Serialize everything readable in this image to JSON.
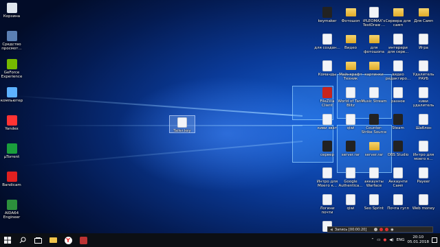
{
  "left_icons": [
    {
      "label": "Корзина",
      "icon": "recycle-bin-icon",
      "color": "#dfe6ee"
    },
    {
      "label": "Средство просмот...",
      "icon": "image-viewer-icon",
      "color": "#5b7fb3"
    },
    {
      "label": "GeForce Experience",
      "icon": "geforce-icon",
      "color": "#76b900"
    },
    {
      "label": "компьютер",
      "icon": "computer-icon",
      "color": "#5db2ff"
    },
    {
      "label": "Yandex",
      "icon": "yandex-browser-icon",
      "color": "#ff3333"
    },
    {
      "label": "µTorrent",
      "icon": "utorrent-icon",
      "color": "#1a9e3c"
    },
    {
      "label": "Bandicam",
      "icon": "bandicam-icon",
      "color": "#e02020"
    },
    {
      "label": "AIDA64 Engineer",
      "icon": "aida64-icon",
      "color": "#2c8f3c"
    }
  ],
  "center_file": {
    "label": "Tailer.key",
    "icon": "document-icon"
  },
  "right_icons": [
    {
      "label": "keymaker",
      "icon": "keymaker-icon",
      "type": "dark"
    },
    {
      "label": "Фотошоп",
      "icon": "folder-icon",
      "type": "folder"
    },
    {
      "label": "iPLEOMAX's TestDraw ...",
      "icon": "document-icon",
      "type": "doc"
    },
    {
      "label": "Сервера для самп",
      "icon": "folder-icon",
      "type": "folder"
    },
    {
      "label": "Для Самп",
      "icon": "folder-icon",
      "type": "folder"
    },
    {
      "label": "для создан...",
      "icon": "document-icon",
      "type": "doc"
    },
    {
      "label": "Видео",
      "icon": "folder-icon",
      "type": "folder"
    },
    {
      "label": "для фотошопа",
      "icon": "folder-icon",
      "type": "folder"
    },
    {
      "label": "интерери для серв...",
      "icon": "document-icon",
      "type": "doc"
    },
    {
      "label": "Игра",
      "icon": "document-icon",
      "type": "doc"
    },
    {
      "label": "Команды",
      "icon": "document-icon",
      "type": "doc"
    },
    {
      "label": "Майнкрафт Техник",
      "icon": "folder-icon",
      "type": "folder"
    },
    {
      "label": "картинки",
      "icon": "folder-icon",
      "type": "folder"
    },
    {
      "label": "видео редактиро...",
      "icon": "video-editor-icon",
      "type": "doc"
    },
    {
      "label": "Удалитель РАУБ",
      "icon": "document-icon",
      "type": "doc"
    },
    {
      "label": "FileZilla Client",
      "icon": "filezilla-icon",
      "type": "red"
    },
    {
      "label": "World of Tank Blitz",
      "icon": "document-icon",
      "type": "doc"
    },
    {
      "label": "Music Stream",
      "icon": "document-icon",
      "type": "doc"
    },
    {
      "label": "разное",
      "icon": "document-icon",
      "type": "doc"
    },
    {
      "label": "киви удалитель",
      "icon": "document-icon",
      "type": "doc"
    },
    {
      "label": "киви зват",
      "icon": "document-icon",
      "type": "doc"
    },
    {
      "label": "qiwi",
      "icon": "document-icon",
      "type": "doc"
    },
    {
      "label": "Counter-Strike Source",
      "icon": "cs-source-icon",
      "type": "dark"
    },
    {
      "label": "Steam",
      "icon": "steam-icon",
      "type": "dark"
    },
    {
      "label": "Шаблон",
      "icon": "document-icon",
      "type": "doc"
    },
    {
      "label": "сервер",
      "icon": "winrar-icon",
      "type": "dark"
    },
    {
      "label": "server.rar",
      "icon": "winrar-icon",
      "type": "dark"
    },
    {
      "label": "server.rar",
      "icon": "folder-icon",
      "type": "folder"
    },
    {
      "label": "OBS Studio",
      "icon": "obs-icon",
      "type": "dark"
    },
    {
      "label": "Интро для моего к...",
      "icon": "document-icon",
      "type": "doc"
    },
    {
      "label": "Интро для Моего к...",
      "icon": "document-icon",
      "type": "doc"
    },
    {
      "label": "Google Authentica...",
      "icon": "document-icon",
      "type": "doc"
    },
    {
      "label": "аккаунты Warface",
      "icon": "document-icon",
      "type": "doc"
    },
    {
      "label": "Аккаунти Самп",
      "icon": "document-icon",
      "type": "doc"
    },
    {
      "label": "Payeer",
      "icon": "document-icon",
      "type": "doc"
    },
    {
      "label": "Логини почти",
      "icon": "document-icon",
      "type": "doc"
    },
    {
      "label": "qiwi",
      "icon": "document-icon",
      "type": "doc"
    },
    {
      "label": "Seo Sprint",
      "icon": "document-icon",
      "type": "doc"
    },
    {
      "label": "Почта гугл",
      "icon": "document-icon",
      "type": "doc"
    },
    {
      "label": "Web money",
      "icon": "document-icon",
      "type": "doc"
    },
    {
      "label": "Yandex",
      "icon": "document-icon",
      "type": "doc"
    }
  ],
  "recorder": {
    "status": "Запись [00:00:20]"
  },
  "taskbar": {
    "language": "ENG",
    "time": "20:10",
    "date": "05.01.2018"
  },
  "colors": {
    "accent": "#1662d8",
    "taskbar": "#0c0f14"
  }
}
